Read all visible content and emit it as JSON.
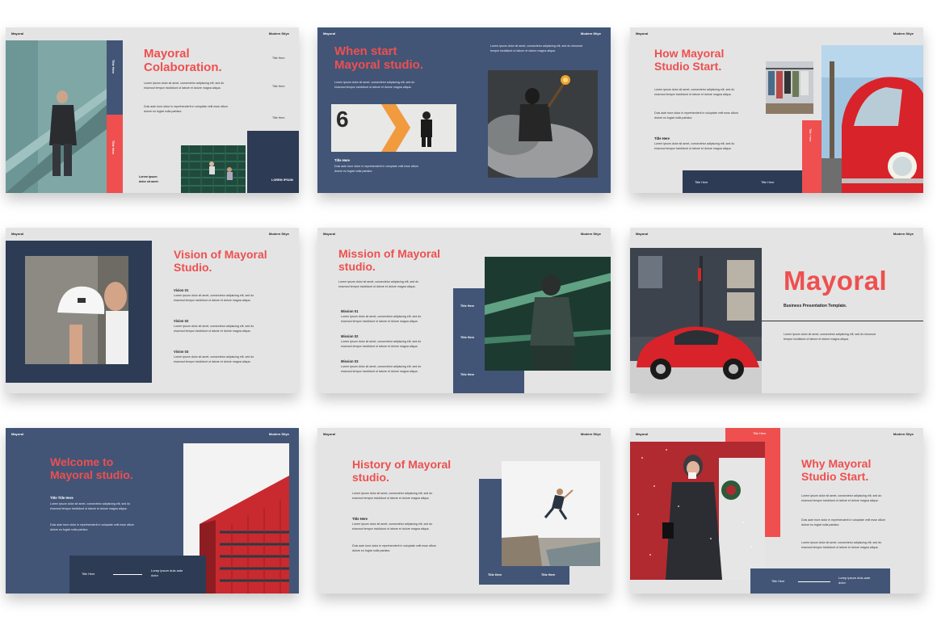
{
  "lorem": {
    "a": "Lorem ipsum dolor sit amet, consectetur adipiscing elit, sed do eiusmod tempor incididunt ut labore et dolore magna aliqua.",
    "b": "Duis aute irure dolor in reprehenderit in voluptate velit esse cillum dolore eu fugiat nulla pariatur."
  },
  "slides": [
    {
      "brand": "Mayoral",
      "style": "Modern Stiye",
      "title": "Mayoral Colaboration.",
      "side_labels": [
        "Title Here",
        "Title Here",
        "Title Here"
      ],
      "vertical_1": "Title Here",
      "vertical_2": "Title Here",
      "caption": "Lorem ipsum dolor sit amet.",
      "bottom_label": "LOREM IPSUM"
    },
    {
      "brand": "Mayoral",
      "style": "Modern Stiye",
      "title": "When start Mayoral studio.",
      "subtitle": "Title Here"
    },
    {
      "brand": "Mayoral",
      "style": "Modern Stiye",
      "title": "How Mayoral Studio Start.",
      "subtitle": "Title Here",
      "vertical": "Title Here",
      "bottom_labels": [
        "Title Here",
        "Title Here"
      ]
    },
    {
      "brand": "Mayoral",
      "style": "Modern Stiye",
      "title": "Vision of Mayoral Studio.",
      "items": [
        "Vision 01",
        "Vision 02",
        "Vision 03"
      ]
    },
    {
      "brand": "Mayoral",
      "style": "Modern Stiye",
      "title": "Mission of Mayoral studio.",
      "items": [
        "Mission 01",
        "Mission 02",
        "Mission 03"
      ],
      "side_labels": [
        "Title Here",
        "Title Here",
        "Title Here"
      ]
    },
    {
      "brand": "Mayoral",
      "style": "Modern Stiye",
      "title": "Mayoral",
      "subtitle": "Business Presentation Template."
    },
    {
      "brand": "Mayoral",
      "style": "Modern Stiye",
      "title": "Welcome to Mayoral studio.",
      "subtitle": "Title Title Here",
      "bottom_label": "Title Here",
      "bottom_text": "Lorep ipsum duis aute dolor"
    },
    {
      "brand": "Mayoral",
      "style": "Modern Stiye",
      "title": "History of Mayoral studio.",
      "subtitle": "Title Here",
      "bottom_labels": [
        "Title Here",
        "Title Here"
      ]
    },
    {
      "brand": "Mayoral",
      "style": "Modern Stiye",
      "title": "Why Mayoral Studio Start.",
      "top_label": "Title Here",
      "bottom_label": "Title Here",
      "bottom_text": "Lorep ipsum duis aute dolor"
    }
  ],
  "colors": {
    "accent": "#ef4f4f",
    "navy": "#425577",
    "slide_bg": "#e4e4e4"
  }
}
